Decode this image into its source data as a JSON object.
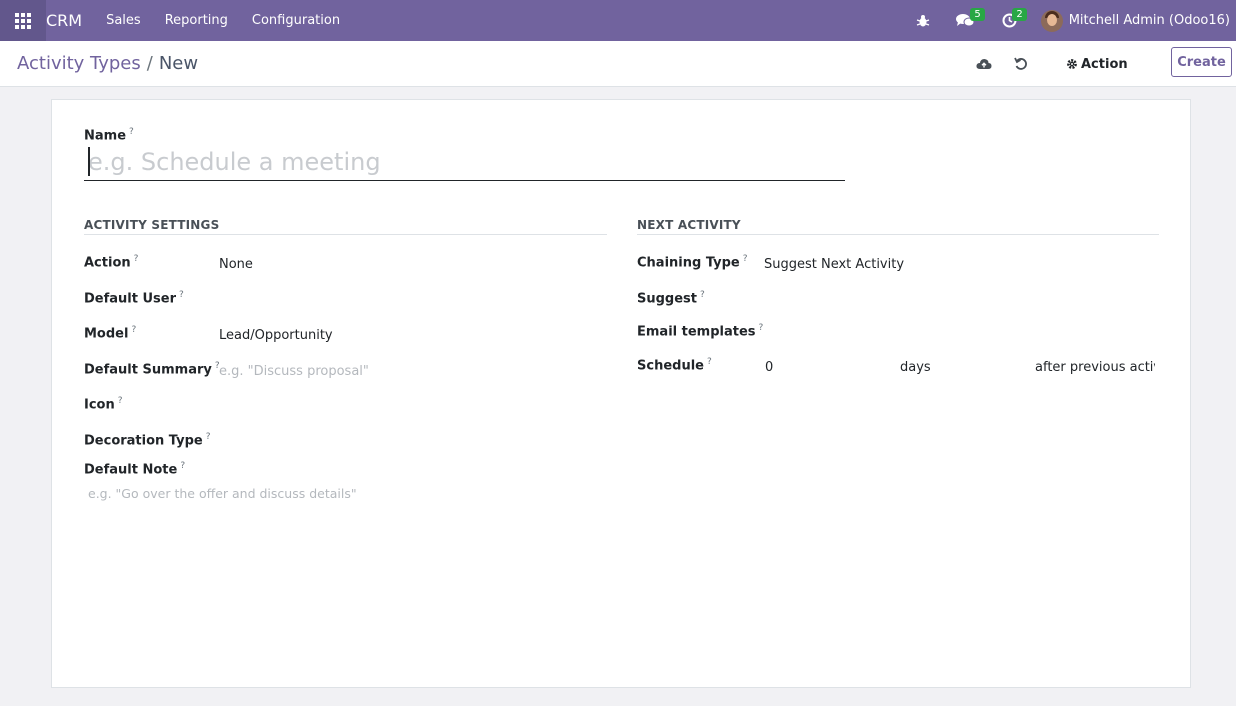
{
  "navbar": {
    "brand": "CRM",
    "menu": [
      "Sales",
      "Reporting",
      "Configuration"
    ],
    "chat_count": "5",
    "activity_count": "2",
    "user_name": "Mitchell Admin (Odoo16)"
  },
  "control_panel": {
    "breadcrumb_parent": "Activity Types",
    "breadcrumb_separator": "/",
    "breadcrumb_current": "New",
    "action_label": "Action",
    "create_label": "Create"
  },
  "form": {
    "name_label": "Name",
    "name_placeholder": "e.g. Schedule a meeting",
    "help_mark": "?",
    "activity_settings": {
      "title": "ACTIVITY SETTINGS",
      "action_label": "Action",
      "action_value": "None",
      "default_user_label": "Default User",
      "model_label": "Model",
      "model_value": "Lead/Opportunity",
      "default_summary_label": "Default Summary",
      "default_summary_placeholder": "e.g. \"Discuss proposal\"",
      "icon_label": "Icon",
      "decoration_type_label": "Decoration Type",
      "default_note_label": "Default Note",
      "default_note_placeholder": "e.g. \"Go over the offer and discuss details\""
    },
    "next_activity": {
      "title": "NEXT ACTIVITY",
      "chaining_type_label": "Chaining Type",
      "chaining_type_value": "Suggest Next Activity",
      "suggest_label": "Suggest",
      "email_templates_label": "Email templates",
      "schedule_label": "Schedule",
      "schedule_value": "0",
      "schedule_unit": "days",
      "schedule_from": "after previous activity"
    }
  }
}
